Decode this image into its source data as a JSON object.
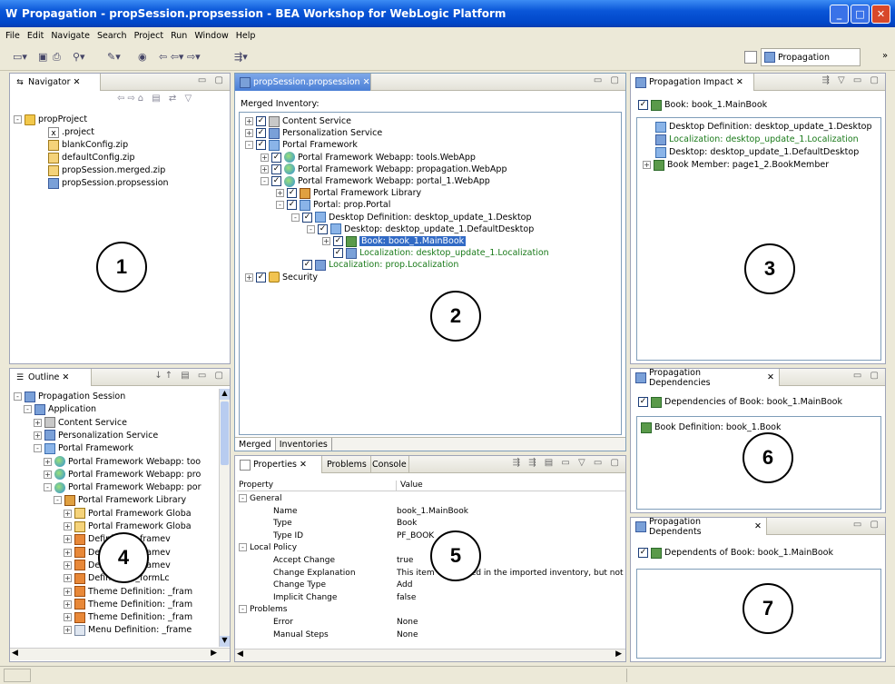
{
  "window": {
    "title": "Propagation - propSession.propsession - BEA Workshop for WebLogic Platform",
    "minimize": "_",
    "maximize": "□",
    "close": "✕"
  },
  "menu": [
    "File",
    "Edit",
    "Navigate",
    "Search",
    "Project",
    "Run",
    "Window",
    "Help"
  ],
  "perspective": {
    "label": "Propagation"
  },
  "navigator": {
    "tab": "Navigator",
    "items": [
      {
        "label": "propProject",
        "icon": "folder-icon"
      },
      {
        "label": ".project",
        "icon": "file-icon"
      },
      {
        "label": "blankConfig.zip",
        "icon": "zip-icon"
      },
      {
        "label": "defaultConfig.zip",
        "icon": "zip-icon"
      },
      {
        "label": "propSession.merged.zip",
        "icon": "zip-icon"
      },
      {
        "label": "propSession.propsession",
        "icon": "session-icon"
      }
    ]
  },
  "editor": {
    "tab": "propSession.propsession",
    "heading": "Merged Inventory:",
    "tree": [
      {
        "label": "Content Service",
        "indent": 0,
        "exp": "+"
      },
      {
        "label": "Personalization Service",
        "indent": 0,
        "exp": "+"
      },
      {
        "label": "Portal Framework",
        "indent": 0,
        "exp": "-"
      },
      {
        "label": "Portal Framework Webapp: tools.WebApp",
        "indent": 1,
        "exp": "+"
      },
      {
        "label": "Portal Framework Webapp: propagation.WebApp",
        "indent": 1,
        "exp": "+"
      },
      {
        "label": "Portal Framework Webapp: portal_1.WebApp",
        "indent": 1,
        "exp": "-"
      },
      {
        "label": "Portal Framework Library",
        "indent": 2,
        "exp": "+"
      },
      {
        "label": "Portal: prop.Portal",
        "indent": 2,
        "exp": "-"
      },
      {
        "label": "Desktop Definition: desktop_update_1.Desktop",
        "indent": 3,
        "exp": "-"
      },
      {
        "label": "Desktop: desktop_update_1.DefaultDesktop",
        "indent": 4,
        "exp": "-"
      },
      {
        "label": "Book: book_1.MainBook",
        "indent": 5,
        "exp": "+",
        "selected": true
      },
      {
        "label": "Localization: desktop_update_1.Localization",
        "indent": 5,
        "exp": "",
        "green": true
      },
      {
        "label": "Localization: prop.Localization",
        "indent": 3,
        "exp": "",
        "green": true
      },
      {
        "label": "Security",
        "indent": 0,
        "exp": "+"
      }
    ],
    "bottom_tabs": [
      "Merged",
      "Inventories"
    ]
  },
  "impact": {
    "tab": "Propagation Impact",
    "header": "Book: book_1.MainBook",
    "items": [
      {
        "label": "Desktop Definition: desktop_update_1.Desktop",
        "green": false
      },
      {
        "label": "Localization: desktop_update_1.Localization",
        "green": true
      },
      {
        "label": "Desktop: desktop_update_1.DefaultDesktop",
        "green": false
      },
      {
        "label": "Book Member: page1_2.BookMember",
        "green": false
      }
    ]
  },
  "dependencies": {
    "tab": "Propagation Dependencies",
    "header": "Dependencies of Book: book_1.MainBook",
    "items": [
      "Book Definition: book_1.Book"
    ]
  },
  "dependents": {
    "tab": "Propagation Dependents",
    "header": "Dependents of Book: book_1.MainBook"
  },
  "outline": {
    "tab": "Outline",
    "items": [
      {
        "label": "Propagation Session",
        "indent": 0,
        "icon": "session"
      },
      {
        "label": "Application",
        "indent": 1,
        "icon": "session"
      },
      {
        "label": "Content Service",
        "indent": 2,
        "icon": "cs"
      },
      {
        "label": "Personalization Service",
        "indent": 2,
        "icon": "session"
      },
      {
        "label": "Portal Framework",
        "indent": 2,
        "icon": "desk"
      },
      {
        "label": "Portal Framework Webapp: too",
        "indent": 3,
        "icon": "globe"
      },
      {
        "label": "Portal Framework Webapp: pro",
        "indent": 3,
        "icon": "globe"
      },
      {
        "label": "Portal Framework Webapp: por",
        "indent": 3,
        "icon": "globe"
      },
      {
        "label": "Portal Framework Library",
        "indent": 4,
        "icon": "lib"
      },
      {
        "label": "Portal Framework Globa",
        "indent": 5,
        "icon": "zip"
      },
      {
        "label": "Portal Framework Globa",
        "indent": 5,
        "icon": "zip"
      },
      {
        "label": "Definition: _framev",
        "indent": 5,
        "icon": "theme"
      },
      {
        "label": "Definition: _framev",
        "indent": 5,
        "icon": "theme"
      },
      {
        "label": "Definition: _framev",
        "indent": 5,
        "icon": "theme"
      },
      {
        "label": "Definition: _formLc",
        "indent": 5,
        "icon": "theme"
      },
      {
        "label": "Theme Definition: _fram",
        "indent": 5,
        "icon": "theme"
      },
      {
        "label": "Theme Definition: _fram",
        "indent": 5,
        "icon": "theme"
      },
      {
        "label": "Theme Definition: _fram",
        "indent": 5,
        "icon": "theme"
      },
      {
        "label": "Menu Definition: _frame",
        "indent": 5,
        "icon": "menu"
      }
    ]
  },
  "properties": {
    "tabs": [
      "Properties",
      "Problems",
      "Console"
    ],
    "col_property": "Property",
    "col_value": "Value",
    "rows": [
      {
        "k": "General",
        "v": "",
        "group": true
      },
      {
        "k": "Name",
        "v": "book_1.MainBook"
      },
      {
        "k": "Type",
        "v": "Book"
      },
      {
        "k": "Type ID",
        "v": "PF_BOOK"
      },
      {
        "k": "Local Policy",
        "v": "",
        "group": true
      },
      {
        "k": "Accept Change",
        "v": "true"
      },
      {
        "k": "Change Explanation",
        "v": "This item was added in the imported inventory, but not i..."
      },
      {
        "k": "Change Type",
        "v": "Add"
      },
      {
        "k": "Implicit Change",
        "v": "false"
      },
      {
        "k": "Problems",
        "v": "",
        "group": true
      },
      {
        "k": "Error",
        "v": "None"
      },
      {
        "k": "Manual Steps",
        "v": "None"
      }
    ]
  },
  "callouts": [
    "1",
    "2",
    "3",
    "4",
    "5",
    "6",
    "7"
  ]
}
